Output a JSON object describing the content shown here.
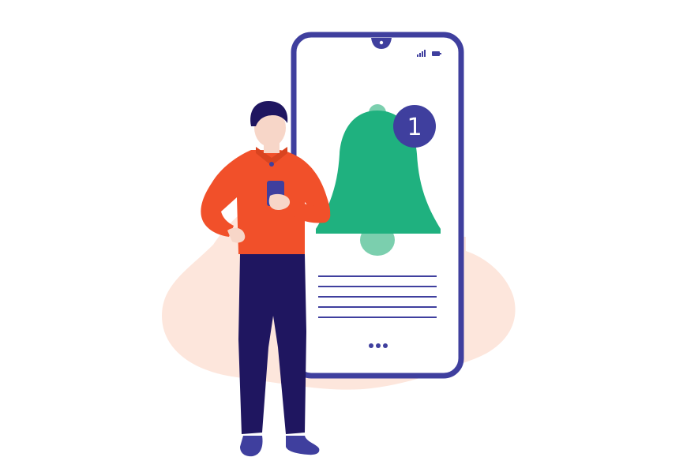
{
  "scene": {
    "description_free": true,
    "notification": {
      "badge_count": "1"
    },
    "colors": {
      "background": "#ffffff",
      "blob": "#fde6dc",
      "phone_frame": "#3f3f9e",
      "phone_screen": "#ffffff",
      "bell": "#1fb17f",
      "bell_light": "#7bcfae",
      "badge": "#3f3f9e",
      "badge_text": "#ffffff",
      "text_lines": "#3f3f9e",
      "shirt": "#f1502a",
      "pants": "#1f1660",
      "hair": "#1f1660",
      "skin": "#f7d6c8",
      "shoes": "#3f3f9e",
      "held_phone": "#3f3f9e"
    },
    "icons": [
      "bell-icon",
      "signal-icon",
      "battery-icon",
      "more-dots-icon"
    ]
  }
}
